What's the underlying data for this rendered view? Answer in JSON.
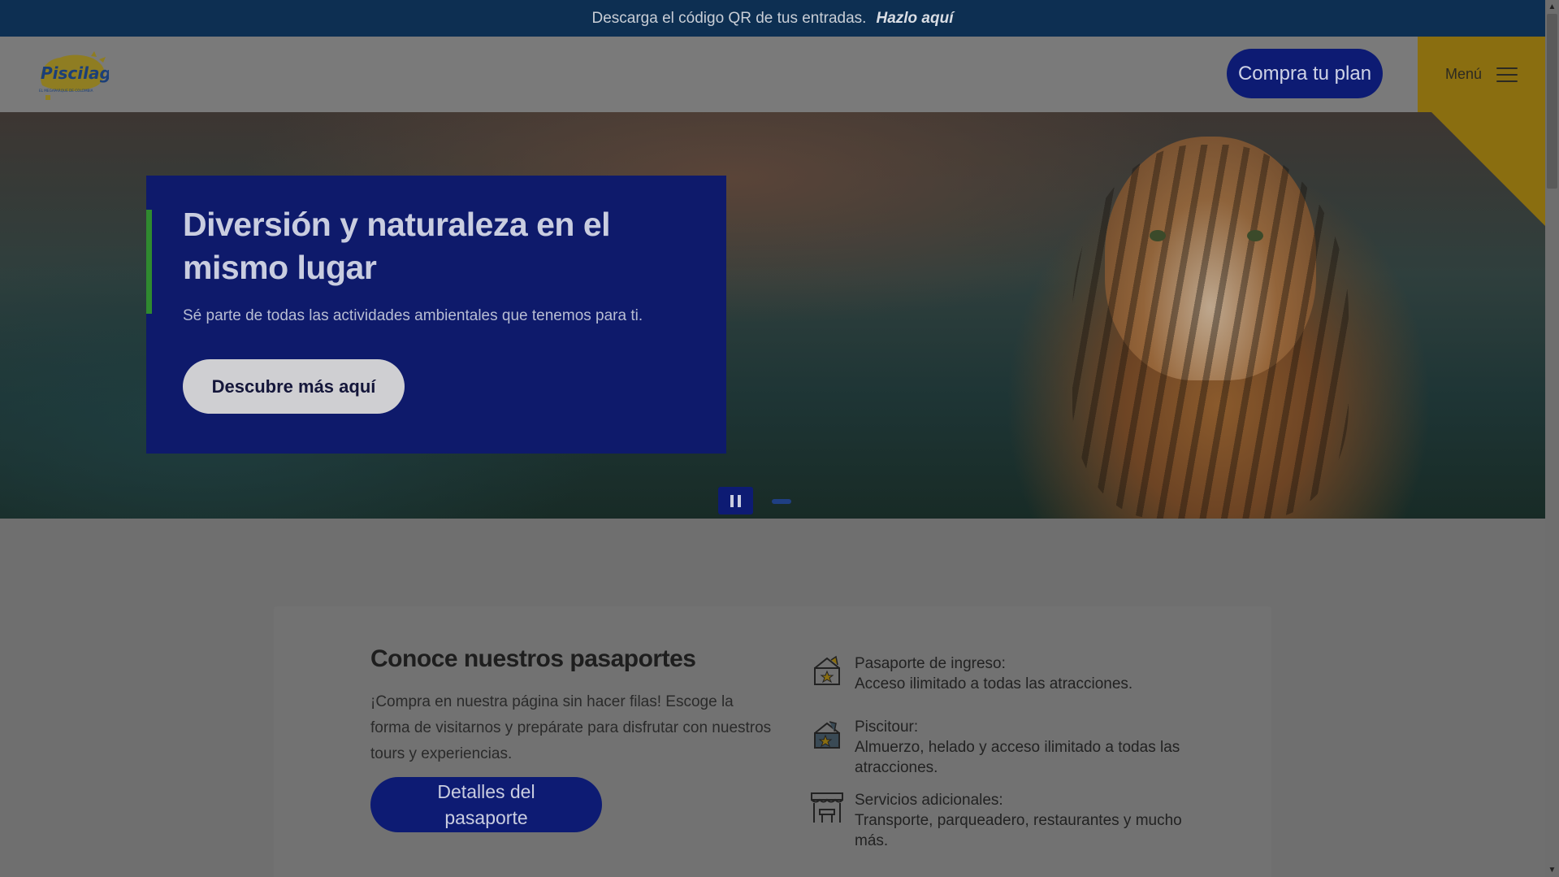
{
  "announcement": {
    "text": "Descarga el código QR de tus entradas.",
    "link": "Hazlo aquí"
  },
  "header": {
    "logo_text": "Piscilago",
    "logo_tagline": "EL MEGAPARQUE DE COLOMBIA",
    "buy_label": "Compra tu plan",
    "menu_label": "Menú"
  },
  "hero": {
    "title": "Diversión y naturaleza en el mismo lugar",
    "subtitle": "Sé parte de todas las actividades ambientales que tenemos para ti.",
    "cta_label": "Descubre más aquí"
  },
  "passports": {
    "title": "Conoce nuestros pasaportes",
    "description": "¡Compra en nuestra página sin hacer filas! Escoge la forma de visitarnos y prepárate para disfrutar con nuestros tours y experiencias.",
    "button_label": "Detalles del pasaporte",
    "features": [
      {
        "title": "Pasaporte de ingreso:",
        "description": "Acceso ilimitado a todas las atracciones.",
        "icon": "ticket-icon"
      },
      {
        "title": "Piscitour:",
        "description": "Almuerzo, helado y acceso ilimitado a todas las atracciones.",
        "icon": "ticket-star-icon"
      },
      {
        "title": "Servicios adicionales:",
        "description": "Transporte, parqueadero, restaurantes y mucho más.",
        "icon": "store-icon"
      }
    ]
  },
  "colors": {
    "brand_blue": "#0d1b73",
    "brand_yellow": "#8a6e10",
    "accent_green": "#2f8a2f"
  }
}
